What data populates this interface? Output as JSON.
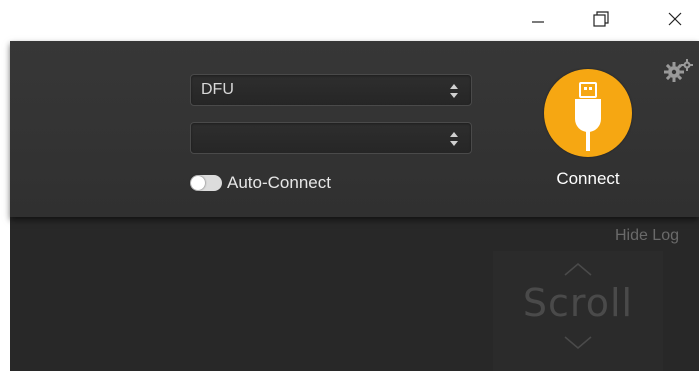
{
  "window": {
    "controls": [
      "minimize-icon",
      "restore-icon",
      "close-icon"
    ]
  },
  "header": {
    "port_select": {
      "value": "DFU"
    },
    "baud_select": {
      "value": ""
    },
    "auto_connect_label": "Auto-Connect",
    "auto_connect_enabled": false,
    "connect_label": "Connect",
    "connect_icon": "usb-plug-icon",
    "settings_icon": "gears-icon"
  },
  "log": {
    "hide_label": "Hide Log",
    "scroll_label": "Scroll"
  },
  "colors": {
    "accent": "#f6a712",
    "header_bg": "#353535",
    "log_bg": "#282828"
  }
}
